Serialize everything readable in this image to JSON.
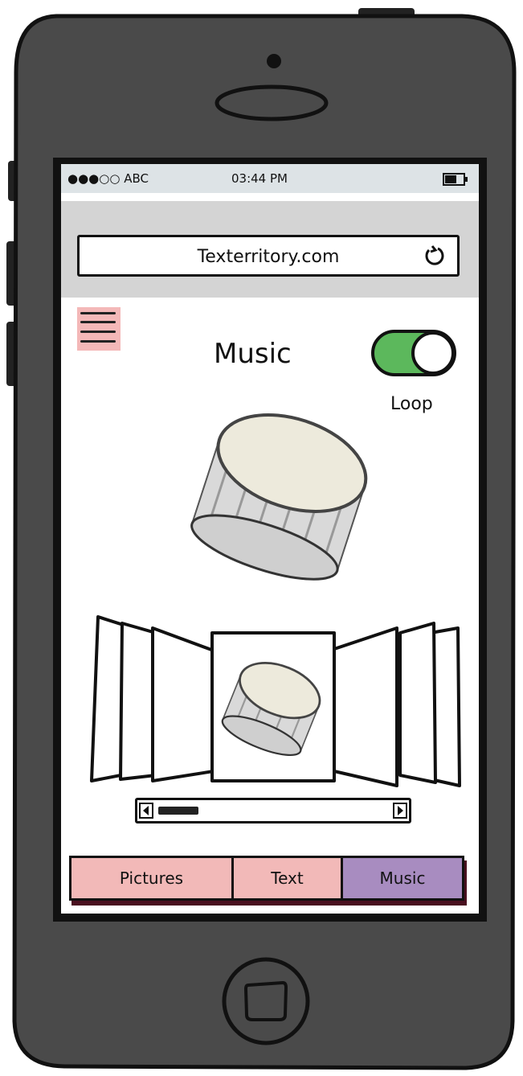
{
  "status_bar": {
    "carrier": "●●●○○ ABC",
    "time": "03:44 PM"
  },
  "browser": {
    "url": "Texterritory.com"
  },
  "page": {
    "title": "Music",
    "loop_label": "Loop",
    "loop_enabled": true
  },
  "tabs": [
    {
      "label": "Pictures",
      "color": "#f2b9b8",
      "selected": false
    },
    {
      "label": "Text",
      "color": "#f2b9b8",
      "selected": false
    },
    {
      "label": "Music",
      "color": "#a88cc0",
      "selected": true
    }
  ],
  "colors": {
    "phone_body": "#4a4a4a",
    "toggle_on": "#5cb85c",
    "menu_bg": "#f4b8b8"
  },
  "icons": [
    "menu-icon",
    "reload-icon",
    "battery-icon",
    "home-button-icon",
    "speaker-icon",
    "camera-icon",
    "scroll-left-icon",
    "scroll-right-icon"
  ]
}
